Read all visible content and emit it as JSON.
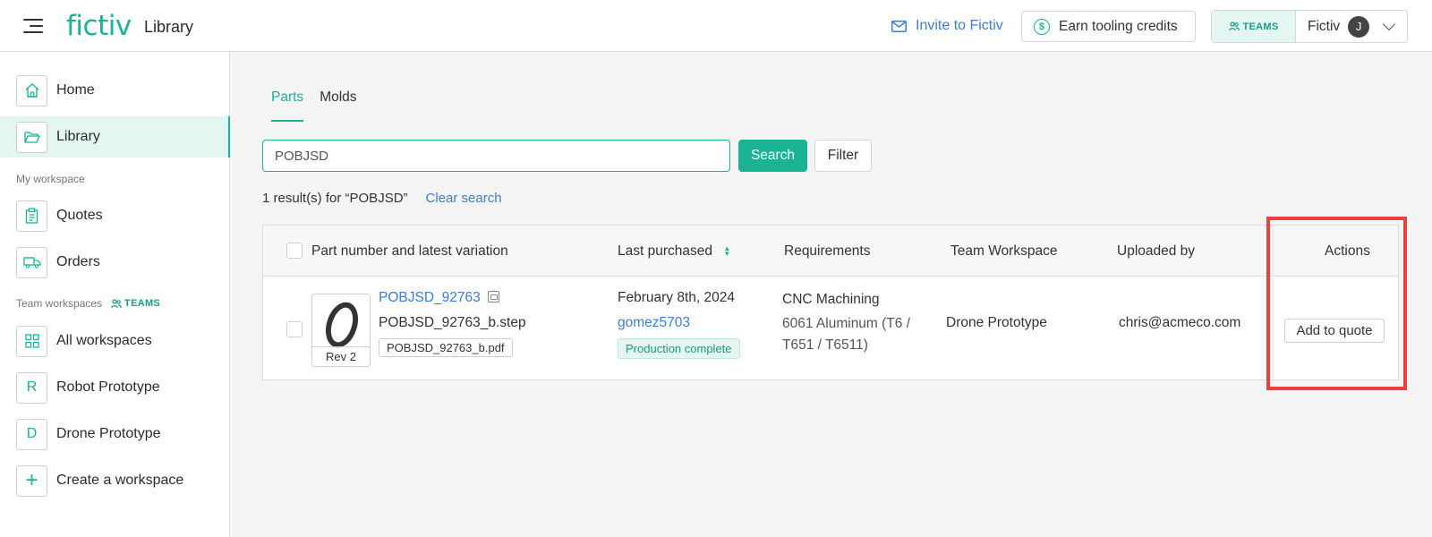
{
  "header": {
    "logo": "fictiv",
    "title": "Library",
    "invite_label": "Invite to Fictiv",
    "earn_label": "Earn tooling credits",
    "teams_label": "TEAMS",
    "account_name": "Fictiv",
    "avatar_initial": "J"
  },
  "sidebar": {
    "home": "Home",
    "library": "Library",
    "my_workspace_label": "My workspace",
    "quotes": "Quotes",
    "orders": "Orders",
    "team_workspaces_label": "Team workspaces",
    "teams_badge": "TEAMS",
    "all_workspaces": "All workspaces",
    "workspaces": [
      {
        "initial": "R",
        "label": "Robot Prototype"
      },
      {
        "initial": "D",
        "label": "Drone Prototype"
      }
    ],
    "create_workspace": "Create a workspace"
  },
  "main": {
    "tabs": [
      {
        "label": "Parts",
        "active": true
      },
      {
        "label": "Molds",
        "active": false
      }
    ],
    "search": {
      "value": "POBJSD",
      "button": "Search",
      "filter": "Filter"
    },
    "results_text": "1 result(s) for “POBJSD”",
    "clear_search": "Clear search",
    "table": {
      "columns": [
        "Part number and latest variation",
        "Last purchased",
        "Requirements",
        "Team Workspace",
        "Uploaded by",
        "Actions"
      ],
      "rows": [
        {
          "part_number": "POBJSD_92763",
          "file_step": "POBJSD_92763_b.step",
          "file_pdf": "POBJSD_92763_b.pdf",
          "revision": "Rev 2",
          "last_purchased_date": "February 8th, 2024",
          "purchaser": "gomez5703",
          "status": "Production complete",
          "requirement_process": "CNC Machining",
          "requirement_material_line1": "6061 Aluminum (T6 /",
          "requirement_material_line2": "T651 / T6511)",
          "team_workspace": "Drone Prototype",
          "uploaded_by": "chris@acmeco.com",
          "action": "Add to quote"
        }
      ]
    }
  },
  "colors": {
    "brand": "#1ab394",
    "link": "#3b7dd8",
    "highlight": "#e84340"
  }
}
